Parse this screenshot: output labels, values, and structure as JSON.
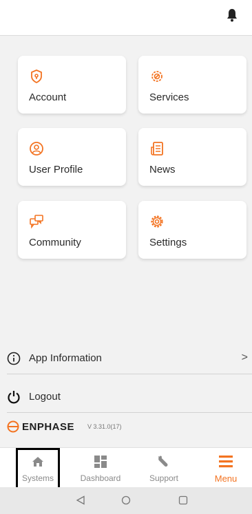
{
  "colors": {
    "accent": "#f37321",
    "background": "#f2f2f2",
    "card": "#ffffff",
    "tab_inactive": "#8a8a8a"
  },
  "header": {
    "icon": "bell-icon"
  },
  "menu_cards": [
    {
      "label": "Account",
      "icon": "shield-icon"
    },
    {
      "label": "Services",
      "icon": "gear-wrench-icon"
    },
    {
      "label": "User Profile",
      "icon": "user-circle-icon"
    },
    {
      "label": "News",
      "icon": "news-icon"
    },
    {
      "label": "Community",
      "icon": "chat-bubbles-icon"
    },
    {
      "label": "Settings",
      "icon": "gear-icon"
    }
  ],
  "list": {
    "app_info": {
      "label": "App Information",
      "icon": "info-icon",
      "chevron": ">"
    },
    "logout": {
      "label": "Logout",
      "icon": "power-icon"
    }
  },
  "brand": {
    "name": "ENPHASE",
    "version": "V 3.31.0(17)"
  },
  "tabs": [
    {
      "label": "Systems",
      "icon": "home-icon",
      "active": false
    },
    {
      "label": "Dashboard",
      "icon": "dashboard-icon",
      "active": false
    },
    {
      "label": "Support",
      "icon": "wrench-icon",
      "active": false
    },
    {
      "label": "Menu",
      "icon": "menu-icon",
      "active": true
    }
  ],
  "system_nav": [
    {
      "icon": "back-triangle-icon"
    },
    {
      "icon": "home-circle-icon"
    },
    {
      "icon": "recents-square-icon"
    }
  ]
}
